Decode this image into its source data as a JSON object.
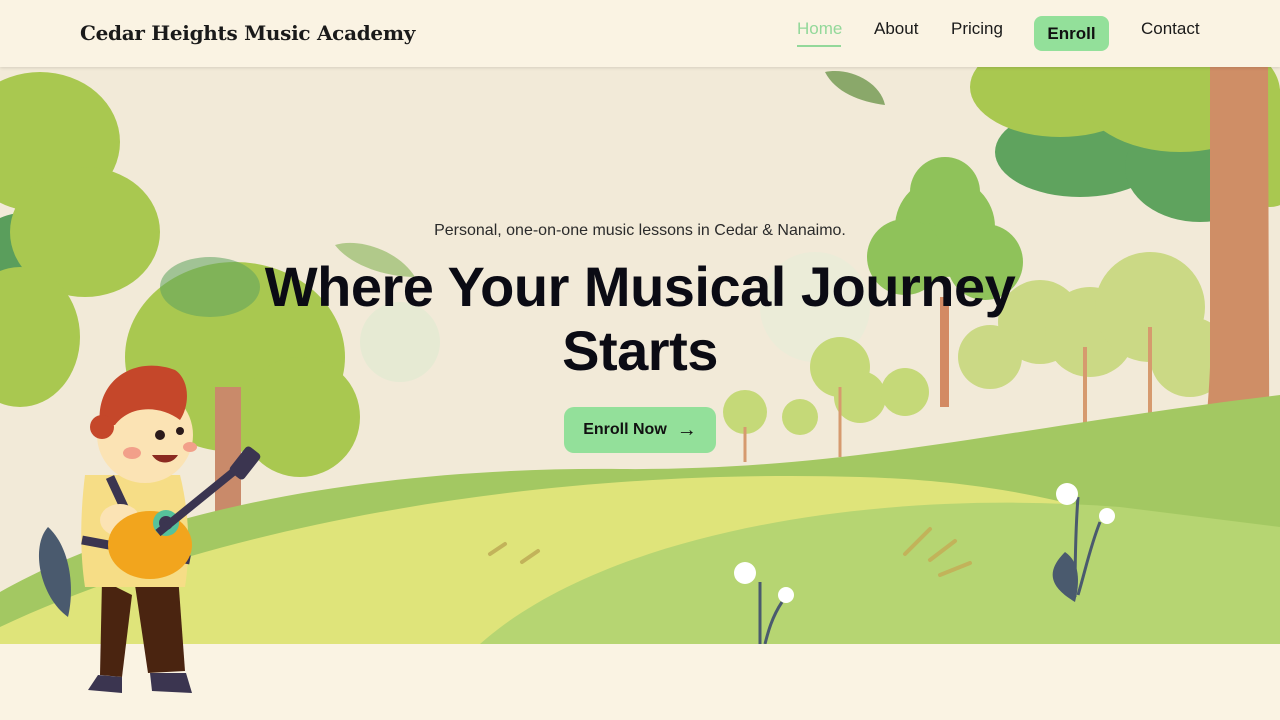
{
  "brand": {
    "name": "Cedar Heights Music Academy"
  },
  "nav": {
    "home": "Home",
    "about": "About",
    "pricing": "Pricing",
    "enroll": "Enroll",
    "contact": "Contact",
    "active": "Home"
  },
  "hero": {
    "tagline": "Personal, one-on-one music lessons in Cedar & Nanaimo.",
    "headline_line1": "Where Your Musical Journey",
    "headline_line2": "Starts",
    "cta_label": "Enroll Now",
    "cta_icon": "arrow-right-icon"
  },
  "colors": {
    "background": "#faf3e3",
    "accent": "#93e09a",
    "active_link": "#93d89a",
    "text": "#0b0b14"
  }
}
